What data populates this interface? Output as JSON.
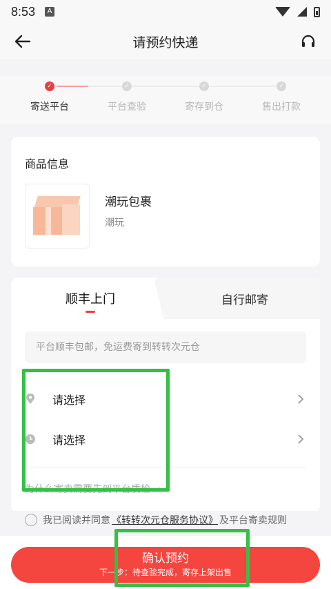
{
  "status": {
    "time": "8:53",
    "notif_glyph": "A"
  },
  "header": {
    "title": "请预约快递"
  },
  "steps": [
    {
      "label": "寄送平台",
      "active": true
    },
    {
      "label": "平台查验",
      "active": false
    },
    {
      "label": "寄存到仓",
      "active": false
    },
    {
      "label": "售出打款",
      "active": false
    }
  ],
  "goods": {
    "heading": "商品信息",
    "name": "潮玩包裹",
    "category": "潮玩"
  },
  "shipping": {
    "tab_active": "顺丰上门",
    "tab_inactive": "自行邮寄",
    "notice": "平台顺丰包邮，免运费寄到转转次元仓",
    "address_select": "请选择",
    "time_select": "请选择",
    "hint": "为什么寄卖需要先到平台质检 →"
  },
  "agreement": {
    "prefix": "我已阅读并同意",
    "link": "《转转次元仓服务协议》",
    "suffix": "及平台寄卖规则"
  },
  "confirm": {
    "label": "确认预约",
    "sub": "下一步：待查验完成，寄存上架出售"
  },
  "colors": {
    "accent": "#f5453f",
    "highlight": "#34c046"
  }
}
